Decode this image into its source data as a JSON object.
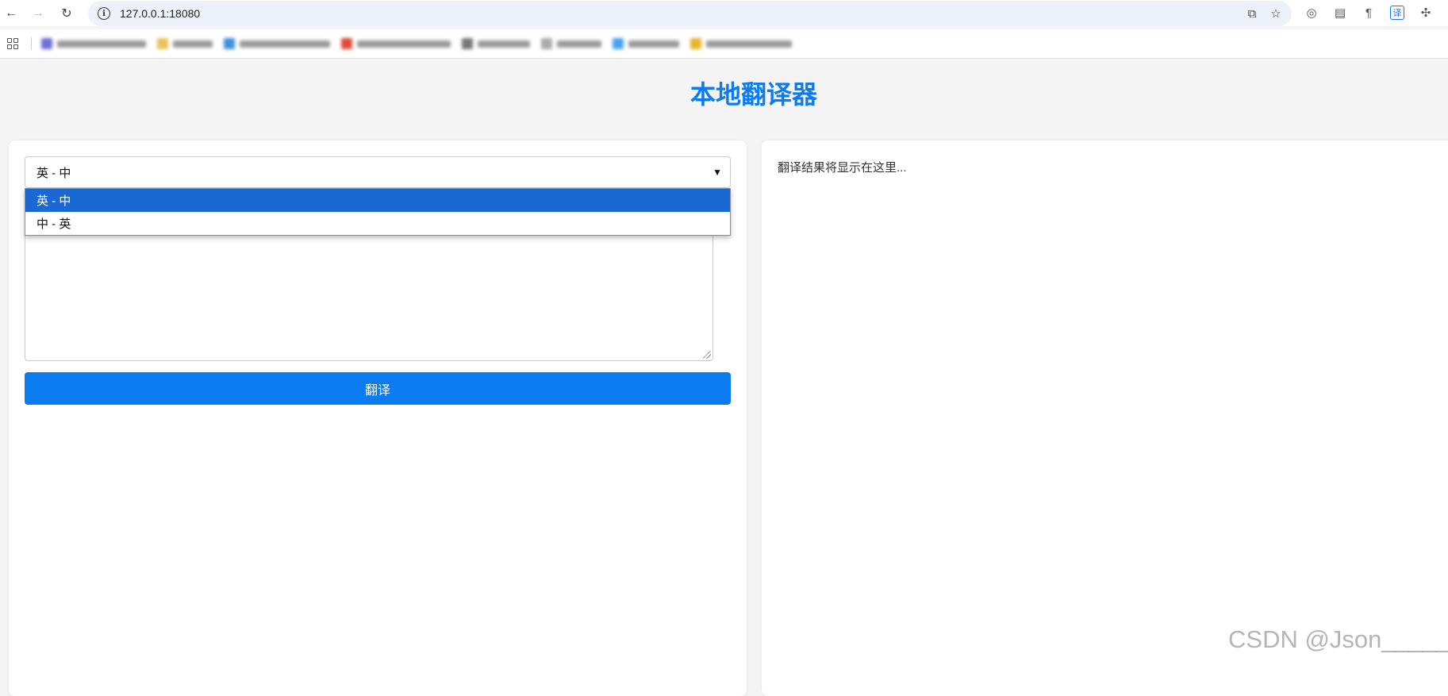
{
  "browser": {
    "url": "127.0.0.1:18080"
  },
  "page": {
    "title": "本地翻译器"
  },
  "translator": {
    "selected_direction": "英 - 中",
    "options": [
      "英 - 中",
      "中 - 英"
    ],
    "translate_button": "翻译",
    "result_placeholder": "翻译结果将显示在这里..."
  },
  "watermark": "CSDN @Json_____",
  "icons": {
    "back": "back-arrow-icon",
    "forward": "forward-arrow-icon",
    "reload": "reload-icon",
    "site_info": "info-icon",
    "translate_page": "translate-page-icon",
    "bookmark_star": "star-icon",
    "apps": "apps-grid-icon"
  },
  "colors": {
    "accent": "#0a7cf0",
    "dropdown_selected": "#1a68d4",
    "page_bg": "#f4f4f4"
  }
}
